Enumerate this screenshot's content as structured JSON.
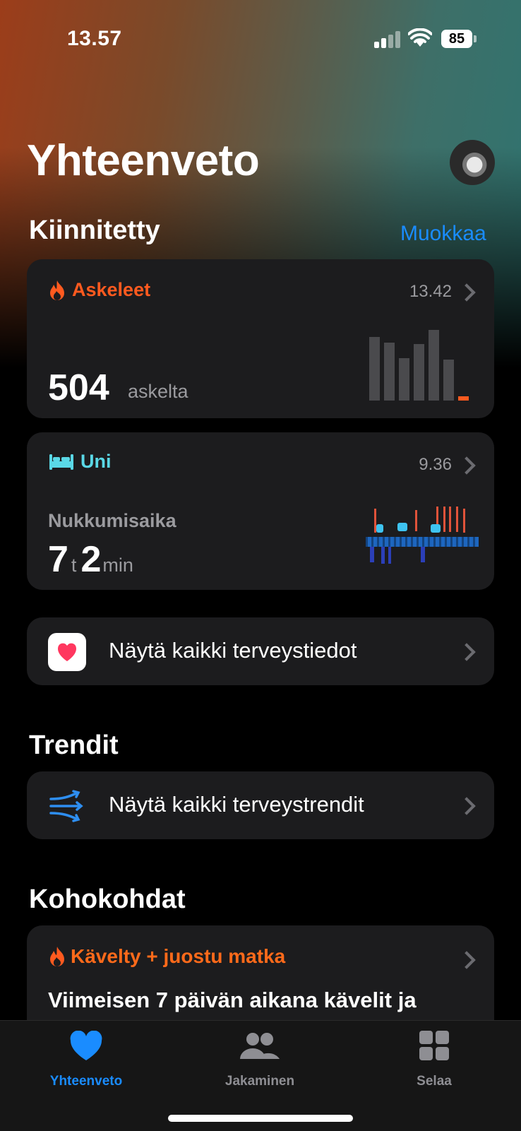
{
  "status_bar": {
    "time": "13.57",
    "battery": "85"
  },
  "header": {
    "title": "Yhteenveto"
  },
  "pinned": {
    "title": "Kiinnitetty",
    "edit_label": "Muokkaa",
    "steps_card": {
      "title": "Askeleet",
      "time": "13.42",
      "value": "504",
      "unit": "askelta",
      "accent": "#ff5a1f"
    },
    "sleep_card": {
      "title": "Uni",
      "time": "9.36",
      "label": "Nukkumisaika",
      "hours": "7",
      "hours_unit": "t",
      "minutes": "2",
      "minutes_unit": "min",
      "accent": "#5ad8e6"
    },
    "show_all_data": {
      "label": "Näytä kaikki terveystiedot",
      "icon": "heart-app-icon"
    }
  },
  "trends": {
    "title": "Trendit",
    "show_all": {
      "label": "Näytä kaikki terveystrendit",
      "icon": "trends-arrows-icon"
    }
  },
  "highlights": {
    "title": "Kohokohdat",
    "card": {
      "title": "Kävelty + juostu matka",
      "text": "Viimeisen 7 päivän aikana kävelit ja"
    }
  },
  "tab_bar": {
    "tabs": [
      {
        "label": "Yhteenveto",
        "icon": "heart-icon",
        "active": true
      },
      {
        "label": "Jakaminen",
        "icon": "people-icon",
        "active": false
      },
      {
        "label": "Selaa",
        "icon": "grid-icon",
        "active": false
      }
    ],
    "active_color": "#1a8cff",
    "inactive_color": "#8e8e93"
  }
}
